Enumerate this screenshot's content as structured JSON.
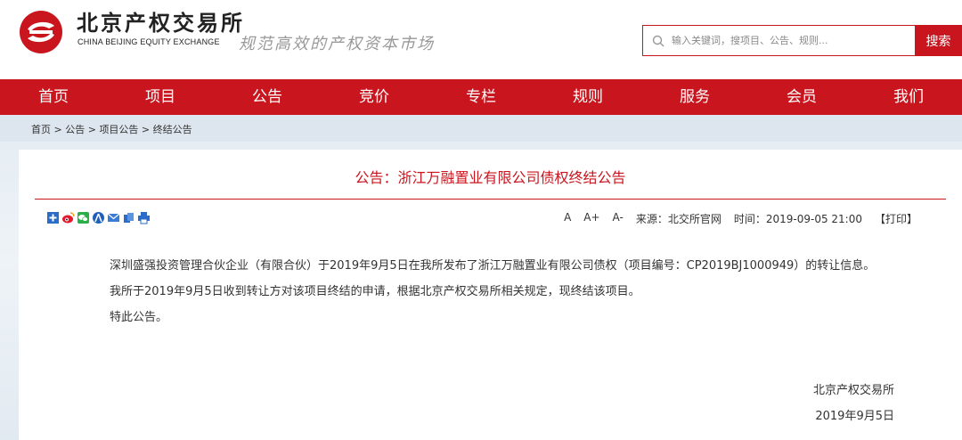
{
  "header": {
    "logo_cn": "北京产权交易所",
    "logo_en": "CHINA BEIJING EQUITY EXCHANGE",
    "slogan": "规范高效的产权资本市场",
    "search_placeholder": "输入关键词，搜项目、公告、规则...",
    "search_button": "搜索",
    "brand_color": "#c9151e"
  },
  "nav": {
    "items": [
      "首页",
      "项目",
      "公告",
      "竞价",
      "专栏",
      "规则",
      "服务",
      "会员",
      "我们"
    ]
  },
  "breadcrumb": {
    "items": [
      "首页",
      "公告",
      "项目公告",
      "终结公告"
    ],
    "separator": " > "
  },
  "article": {
    "title": "公告：浙江万融置业有限公司债权终结公告",
    "share_icons": [
      "share-plus-icon",
      "weibo-icon",
      "wechat-icon",
      "renren-icon",
      "email-icon",
      "copy-icon",
      "print-small-icon"
    ],
    "font_sizes": [
      "A",
      "A+",
      "A-"
    ],
    "source": "来源：北交所官网",
    "time": "时间：2019-09-05 21:00",
    "print": "【打印】",
    "paragraphs": [
      "深圳盛强投资管理合伙企业（有限合伙）于2019年9月5日在我所发布了浙江万融置业有限公司债权（项目编号：CP2019BJ1000949）的转让信息。",
      "我所于2019年9月5日收到转让方对该项目终结的申请，根据北京产权交易所相关规定，现终结该项目。",
      "特此公告。"
    ],
    "signature": "北京产权交易所",
    "date": "2019年9月5日"
  }
}
